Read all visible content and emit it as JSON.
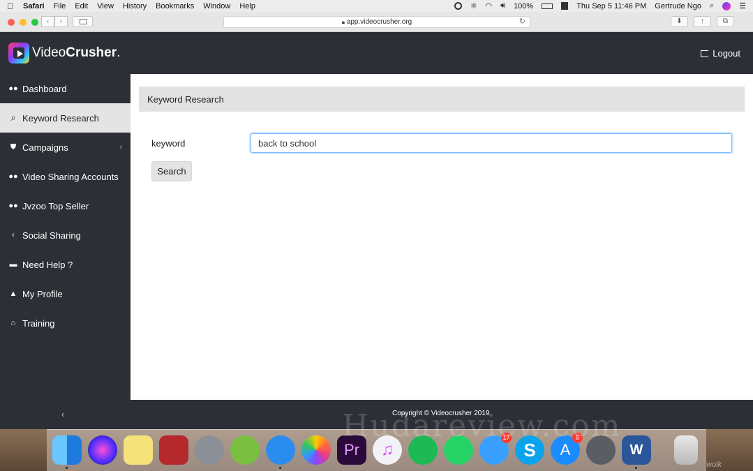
{
  "menubar": {
    "app": "Safari",
    "items": [
      "File",
      "Edit",
      "View",
      "History",
      "Bookmarks",
      "Window",
      "Help"
    ],
    "battery": "100%",
    "datetime": "Thu Sep 5  11:46 PM",
    "user": "Gertrude Ngo"
  },
  "browser": {
    "url": "app.videocrusher.org"
  },
  "header": {
    "logo_light": "Video",
    "logo_bold": "Crusher",
    "logo_dot": ".",
    "logout": "Logout"
  },
  "sidebar": {
    "items": [
      {
        "label": "Dashboard",
        "icon": "users-icon"
      },
      {
        "label": "Keyword Research",
        "icon": "search-icon",
        "active": true
      },
      {
        "label": "Campaigns",
        "icon": "shield-icon"
      },
      {
        "label": "Video Sharing Accounts",
        "icon": "users-icon"
      },
      {
        "label": "Jvzoo Top Seller",
        "icon": "users-icon"
      },
      {
        "label": "Social Sharing",
        "icon": "share-icon"
      },
      {
        "label": "Need Help ?",
        "icon": "comment-icon"
      },
      {
        "label": "My Profile",
        "icon": "user-icon"
      },
      {
        "label": "Training",
        "icon": "bank-icon"
      }
    ]
  },
  "main": {
    "panel_title": "Keyword Research",
    "keyword_label": "keyword",
    "keyword_value": "back to school",
    "search_button": "Search"
  },
  "footer": {
    "copyright": "Copyright © Videocrusher 2019"
  },
  "dock": {
    "apps": [
      "Finder",
      "Siri",
      "Stickies",
      "Photo Booth",
      "Launchpad",
      "Chrome Canary",
      "Safari",
      "Photos",
      "Premiere Pro",
      "iTunes",
      "Spotify",
      "WhatsApp",
      "Messages",
      "Skype",
      "App Store",
      "System Preferences",
      "Word",
      "Trash"
    ],
    "badges": {
      "Messages": "17",
      "App Store": "5"
    }
  },
  "watermark": "Hudareview.com",
  "corner_text": "wolk",
  "colors": {
    "sidebar_bg": "#2c2f36",
    "active_item_bg": "#e4e4e4",
    "input_focus": "#80bdff"
  }
}
